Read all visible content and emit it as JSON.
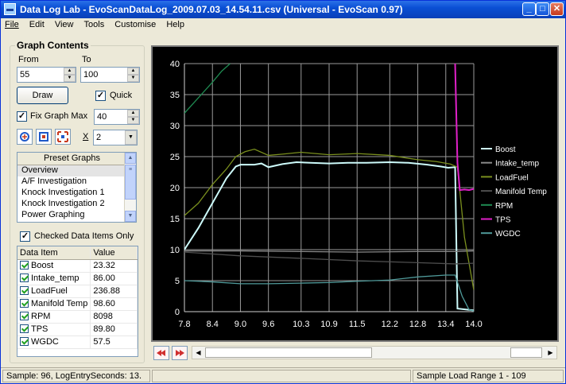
{
  "window": {
    "title": "Data Log Lab - EvoScanDataLog_2009.07.03_14.54.11.csv (Universal - EvoScan 0.97)",
    "minimize_glyph": "_",
    "maximize_glyph": "□",
    "close_glyph": "✕"
  },
  "menu": [
    "File",
    "Edit",
    "View",
    "Tools",
    "Customise",
    "Help"
  ],
  "graph_contents": {
    "title": "Graph Contents",
    "from_label": "From",
    "from_value": "55",
    "to_label": "To",
    "to_value": "100",
    "draw_label": "Draw",
    "quick_label": "Quick",
    "quick_checked": true,
    "fix_graph_max_label": "Fix Graph Max",
    "fix_graph_max_checked": true,
    "fix_graph_max_value": "40",
    "multiplier_label": "X",
    "multiplier_value": "2",
    "checked_only_label": "Checked Data Items Only",
    "checked_only_checked": true
  },
  "preset_graphs": {
    "header": "Preset Graphs",
    "items": [
      "Overview",
      "A/F Investigation",
      "Knock Investigation 1",
      "Knock Investigation 2",
      "Power Graphing"
    ],
    "selected": "Overview"
  },
  "data_items": {
    "columns": [
      "Data Item",
      "Value"
    ],
    "rows": [
      {
        "name": "Boost",
        "value": "23.32",
        "checked": true
      },
      {
        "name": "Intake_temp",
        "value": "86.00",
        "checked": true
      },
      {
        "name": "LoadFuel",
        "value": "236.88",
        "checked": true
      },
      {
        "name": "Manifold Temp",
        "value": "98.60",
        "checked": true
      },
      {
        "name": "RPM",
        "value": "8098",
        "checked": true
      },
      {
        "name": "TPS",
        "value": "89.80",
        "checked": true
      },
      {
        "name": "WGDC",
        "value": "57.5",
        "checked": true
      }
    ]
  },
  "status": {
    "left": "Sample: 96, LogEntrySeconds: 13.",
    "right": "Sample Load Range 1 - 109"
  },
  "chart_data": {
    "type": "line",
    "ylim": [
      0,
      40
    ],
    "xlim": [
      7.8,
      14.0
    ],
    "xticks": [
      "7.8",
      "8.4",
      "9.0",
      "9.6",
      "10.3",
      "10.9",
      "11.5",
      "12.2",
      "12.8",
      "13.4",
      "14.0"
    ],
    "yticks": [
      "0",
      "5",
      "10",
      "15",
      "20",
      "25",
      "30",
      "35",
      "40"
    ],
    "grid": true,
    "legend_position": "right",
    "series": [
      {
        "name": "Boost",
        "color": "#cdfbfb",
        "x": [
          7.8,
          8.1,
          8.4,
          8.7,
          8.9,
          9.0,
          9.3,
          9.45,
          9.6,
          9.9,
          10.2,
          10.5,
          10.9,
          11.3,
          11.7,
          12.2,
          12.6,
          13.0,
          13.3,
          13.45,
          13.6,
          13.65,
          14.0
        ],
        "y": [
          10,
          13.5,
          17.5,
          21.5,
          23.4,
          23.7,
          23.7,
          23.9,
          23.3,
          23.8,
          24.1,
          24.0,
          23.9,
          24.0,
          24.0,
          24.1,
          24.0,
          23.7,
          23.4,
          23.2,
          23.3,
          0.5,
          0.2
        ]
      },
      {
        "name": "Intake_temp",
        "color": "#8a8a8a",
        "x": [
          7.8,
          9.0,
          10.3,
          11.5,
          12.8,
          13.4,
          13.6,
          14.0
        ],
        "y": [
          9.8,
          9.8,
          9.7,
          9.6,
          9.7,
          9.7,
          9.7,
          9.8
        ]
      },
      {
        "name": "LoadFuel",
        "color": "#7a8f1e",
        "x": [
          7.8,
          8.1,
          8.4,
          8.7,
          8.9,
          9.1,
          9.3,
          9.6,
          9.9,
          10.3,
          10.9,
          11.5,
          12.2,
          12.8,
          13.2,
          13.5,
          13.65,
          13.8,
          14.0
        ],
        "y": [
          15.5,
          17.5,
          20.5,
          23,
          25,
          25.8,
          26.2,
          25.2,
          25.4,
          25.7,
          25.3,
          25.5,
          25.2,
          24.5,
          24.2,
          23.8,
          23.3,
          12,
          3.5
        ]
      },
      {
        "name": "Manifold Temp",
        "color": "#4e4e4e",
        "x": [
          7.8,
          9.0,
          10.3,
          11.5,
          12.8,
          13.6,
          14.0
        ],
        "y": [
          9.6,
          9.0,
          8.6,
          8.2,
          7.9,
          7.7,
          7.8
        ]
      },
      {
        "name": "RPM",
        "color": "#1f8b52",
        "x": [
          7.8,
          8.1,
          8.4,
          8.6,
          8.78
        ],
        "y": [
          32,
          34.5,
          37,
          38.8,
          40
        ]
      },
      {
        "name": "TPS",
        "color": "#e020c8",
        "x": [
          13.6,
          13.65,
          13.7,
          13.8,
          13.9,
          14.0
        ],
        "y": [
          40,
          24,
          19.6,
          19.7,
          19.6,
          19.8
        ]
      },
      {
        "name": "WGDC",
        "color": "#4f9a9a",
        "x": [
          7.8,
          8.4,
          9.0,
          9.6,
          10.3,
          10.9,
          11.5,
          12.2,
          12.8,
          13.4,
          13.6,
          13.75,
          13.9,
          14.0
        ],
        "y": [
          5.0,
          4.8,
          4.5,
          4.5,
          4.6,
          4.7,
          4.9,
          5.1,
          5.6,
          5.9,
          5.9,
          2.5,
          0.3,
          0.1
        ]
      }
    ]
  }
}
